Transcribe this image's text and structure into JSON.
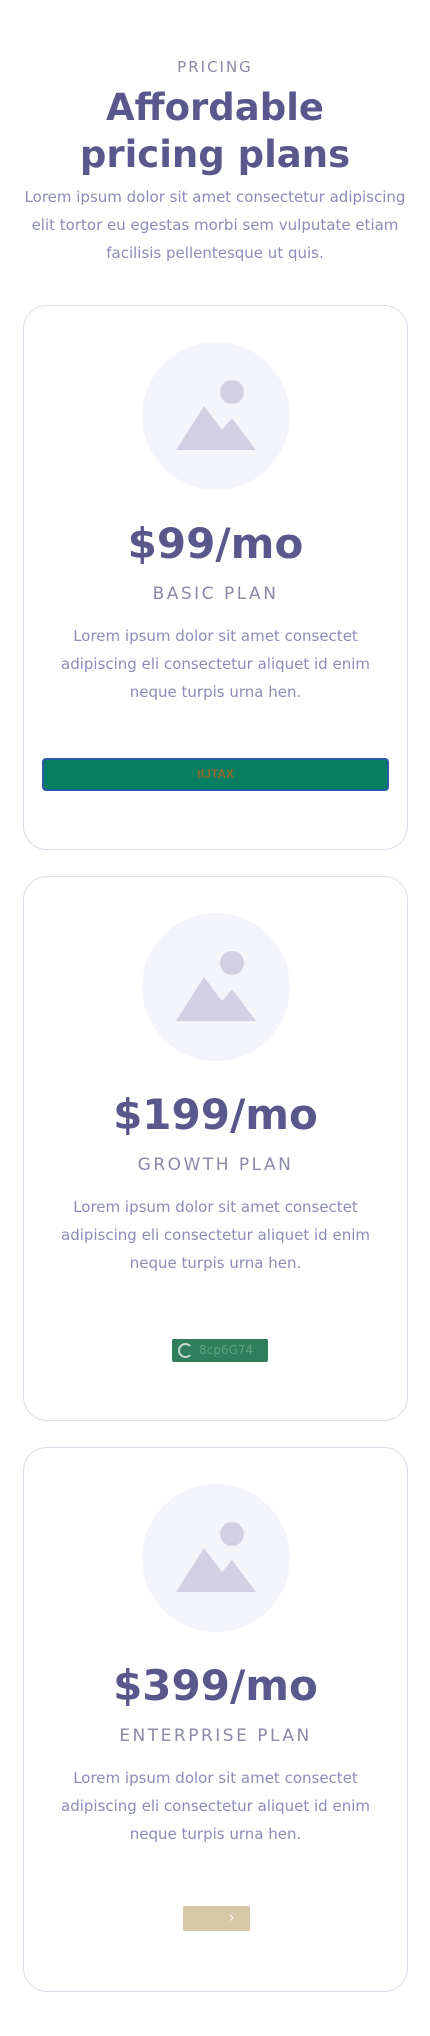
{
  "header": {
    "eyebrow": "PRICING",
    "title": "Affordable pricing plans",
    "intro": "Lorem ipsum dolor sit amet consectetur adipiscing elit tortor eu egestas morbi sem vulputate etiam facilisis pellentesque ut quis."
  },
  "plans": [
    {
      "price": "$99/mo",
      "name": "BASIC PLAN",
      "description": "Lorem ipsum dolor sit amet consectet adipiscing eli consectetur aliquet id enim neque turpis urna hen.",
      "button_label": "tlJTAX",
      "image_icon": "image-placeholder-icon"
    },
    {
      "price": "$199/mo",
      "name": "GROWTH PLAN",
      "description": "Lorem ipsum dolor sit amet consectet adipiscing eli consectetur aliquet id enim neque turpis urna hen.",
      "button_label": "8cp6G74",
      "button_icon": "spinner-icon",
      "image_icon": "image-placeholder-icon"
    },
    {
      "price": "$399/mo",
      "name": "ENTERPRISE PLAN",
      "description": "Lorem ipsum dolor sit amet consectet adipiscing eli consectetur aliquet id enim neque turpis urna hen.",
      "button_label": "",
      "button_icon": "chevron-right-icon",
      "image_icon": "image-placeholder-icon"
    }
  ],
  "colors": {
    "heading": "#5a578c",
    "muted": "#8d8cb7",
    "card_border": "#dcdbe8",
    "basic_button_bg": "#067e62",
    "growth_button_bg": "#2f7f5c",
    "enterprise_button_bg": "#d7c9a8"
  }
}
